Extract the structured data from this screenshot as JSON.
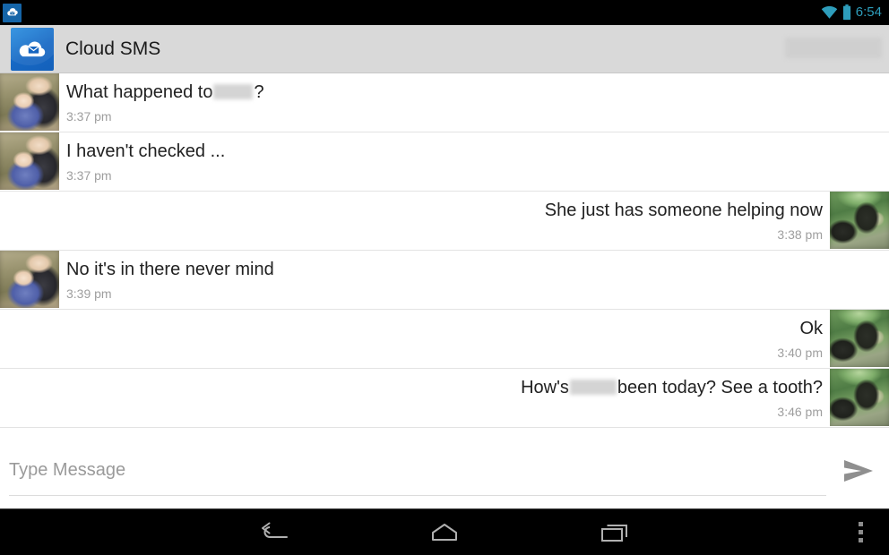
{
  "status_bar": {
    "notification_icon": "cloud-notification-icon",
    "wifi_icon": "wifi-icon",
    "battery_icon": "battery-icon",
    "clock": "6:54",
    "accent_color": "#2e9dbb",
    "background": "#000000"
  },
  "action_bar": {
    "app_icon": "cloud-sms-app-icon",
    "title": "Cloud SMS",
    "background": "#d9d9d9",
    "redacted_contact": ""
  },
  "conversation": {
    "messages": [
      {
        "direction": "incoming",
        "avatar": "indoor",
        "text_before": "What happened to",
        "redacted": true,
        "redact_width": "w1",
        "text_after": "?",
        "time": "3:37 pm"
      },
      {
        "direction": "incoming",
        "avatar": "indoor",
        "text_before": "I haven't checked ...",
        "redacted": false,
        "text_after": "",
        "time": "3:37 pm"
      },
      {
        "direction": "outgoing",
        "avatar": "outdoor",
        "text_before": "She just has someone helping now",
        "redacted": false,
        "text_after": "",
        "time": "3:38 pm"
      },
      {
        "direction": "incoming",
        "avatar": "indoor",
        "text_before": "No it's in there never mind",
        "redacted": false,
        "text_after": "",
        "time": "3:39 pm"
      },
      {
        "direction": "outgoing",
        "avatar": "outdoor",
        "text_before": "Ok",
        "redacted": false,
        "text_after": "",
        "time": "3:40 pm"
      },
      {
        "direction": "outgoing",
        "avatar": "outdoor",
        "text_before": "How's",
        "redacted": true,
        "redact_width": "w2",
        "text_after": "been today?  See a tooth?",
        "time": "3:46 pm"
      }
    ]
  },
  "compose": {
    "placeholder": "Type Message",
    "value": "",
    "send_icon": "send-arrow-icon"
  },
  "nav_bar": {
    "back_icon": "back-arrow-icon",
    "home_icon": "home-icon",
    "recents_icon": "recent-apps-icon",
    "overflow_icon": "overflow-menu-icon",
    "background": "#000000"
  }
}
